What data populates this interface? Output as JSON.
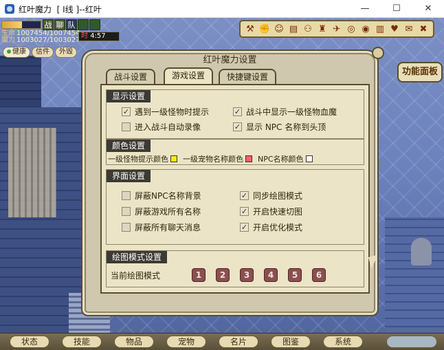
{
  "window": {
    "title": "红叶魔力  [ I线 ]--红叶",
    "minimize": "—",
    "maximize": "☐",
    "close": "✕"
  },
  "hud": {
    "mode_icons": [
      "战",
      "聊",
      "队",
      "",
      ""
    ],
    "hp_fraction": 0.52,
    "hp_label": "生命",
    "hp_value": "1007454/1007454",
    "mp_label": "魔力",
    "mp_value": "1003027/1003027",
    "clock_label": "时",
    "clock_value": "4:57",
    "status_buttons": [
      "健康",
      "信件",
      "外毁"
    ],
    "toolbar_icons": [
      "axe-icon",
      "fist-icon",
      "people-icon",
      "card-icon",
      "group-icon",
      "castle-icon",
      "run-icon",
      "coin-icon",
      "eye-icon",
      "scroll-icon",
      "heart-icon",
      "gift-icon",
      "tools-icon"
    ]
  },
  "dialog": {
    "title": "红叶魔力设置",
    "side_panel": "功能面板",
    "tabs": [
      "战斗设置",
      "游戏设置",
      "快捷键设置"
    ],
    "active_tab": 1,
    "sections": {
      "display": {
        "title": "显示设置",
        "options": [
          {
            "label": "遇到一级怪物时提示",
            "checked": true
          },
          {
            "label": "战斗中显示一级怪物血魔",
            "checked": true
          },
          {
            "label": "进入战斗自动录像",
            "checked": false
          },
          {
            "label": "显示 NPC 名称到头顶",
            "checked": true
          }
        ]
      },
      "color": {
        "title": "颜色设置",
        "items": [
          {
            "label": "一级怪物提示颜色",
            "color": "#ffee00"
          },
          {
            "label": "一级宠物名称颜色",
            "color": "#ff6060"
          },
          {
            "label": "NPC名称颜色",
            "color": "#ffffff"
          }
        ]
      },
      "ui": {
        "title": "界面设置",
        "options": [
          {
            "label": "屏蔽NPC名称背景",
            "checked": false
          },
          {
            "label": "同步绘图模式",
            "checked": true
          },
          {
            "label": "屏蔽游戏所有名称",
            "checked": false
          },
          {
            "label": "开启快速切图",
            "checked": true
          },
          {
            "label": "屏蔽所有聊天消息",
            "checked": false
          },
          {
            "label": "开启优化模式",
            "checked": true
          }
        ]
      },
      "draw": {
        "title": "绘图模式设置",
        "label": "当前绘图模式",
        "modes": [
          "1",
          "2",
          "3",
          "4",
          "5",
          "6"
        ]
      }
    }
  },
  "bottom_menu": [
    "状态",
    "技能",
    "物品",
    "宠物",
    "名片",
    "图鉴",
    "系统"
  ]
}
